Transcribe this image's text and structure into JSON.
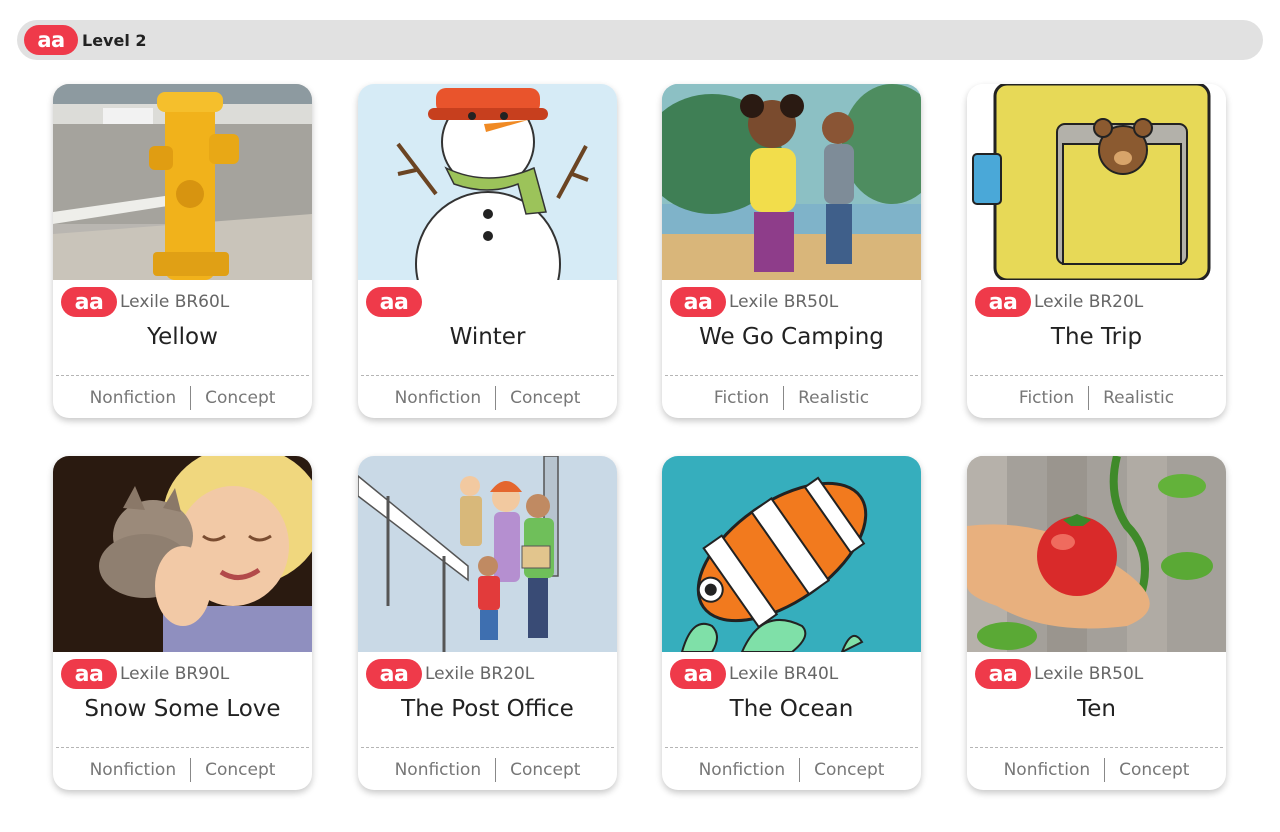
{
  "header": {
    "badge": "aa",
    "level": "Level 2"
  },
  "books": [
    {
      "title": "Yellow",
      "badge": "aa",
      "lexile": "Lexile BR60L",
      "genre": "Nonfiction",
      "type": "Concept",
      "cover": "fire-hydrant"
    },
    {
      "title": "Winter",
      "badge": "aa",
      "lexile": "",
      "genre": "Nonfiction",
      "type": "Concept",
      "cover": "snowman"
    },
    {
      "title": "We Go Camping",
      "badge": "aa",
      "lexile": "Lexile BR50L",
      "genre": "Fiction",
      "type": "Realistic",
      "cover": "kids-camping"
    },
    {
      "title": "The Trip",
      "badge": "aa",
      "lexile": "Lexile BR20L",
      "genre": "Fiction",
      "type": "Realistic",
      "cover": "suitcase-teddy-bear"
    },
    {
      "title": "Snow Some Love",
      "badge": "aa",
      "lexile": "Lexile BR90L",
      "genre": "Nonfiction",
      "type": "Concept",
      "cover": "girl-with-kitten"
    },
    {
      "title": "The Post Office",
      "badge": "aa",
      "lexile": "Lexile BR20L",
      "genre": "Nonfiction",
      "type": "Concept",
      "cover": "post-office-line"
    },
    {
      "title": "The Ocean",
      "badge": "aa",
      "lexile": "Lexile BR40L",
      "genre": "Nonfiction",
      "type": "Concept",
      "cover": "clownfish"
    },
    {
      "title": "Ten",
      "badge": "aa",
      "lexile": "Lexile BR50L",
      "genre": "Nonfiction",
      "type": "Concept",
      "cover": "hand-holding-tomato"
    }
  ]
}
